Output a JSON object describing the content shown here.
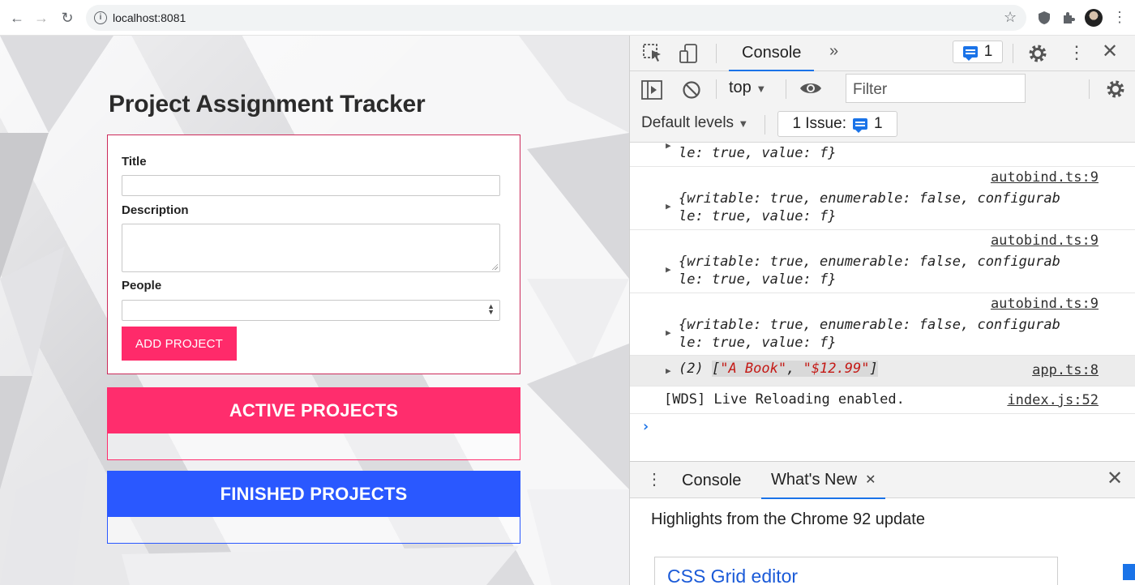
{
  "browser": {
    "url": "localhost:8081",
    "icons": [
      "back-arrow-icon",
      "forward-arrow-icon",
      "reload-icon",
      "site-info-icon",
      "bookmark-star-icon",
      "shield-extension-icon",
      "puzzle-extensions-icon",
      "profile-avatar",
      "browser-menu-icon"
    ]
  },
  "app": {
    "title": "Project Assignment Tracker",
    "form": {
      "title_label": "Title",
      "title_value": "",
      "description_label": "Description",
      "description_value": "",
      "people_label": "People",
      "people_value": "",
      "submit_label": "ADD PROJECT"
    },
    "active_heading": "ACTIVE PROJECTS",
    "finished_heading": "FINISHED PROJECTS",
    "colors": {
      "active": "#ff2d6d",
      "finished": "#2a58ff"
    }
  },
  "devtools": {
    "main_tab": "Console",
    "more_tabs_glyph": "»",
    "message_count": "1",
    "context": "top",
    "filter_placeholder": "Filter",
    "levels_label": "Default levels",
    "issues_label": "1 Issue:",
    "issues_count": "1",
    "console": {
      "partial_line": "le: true, value: f}",
      "entries": [
        {
          "source": "autobind.ts:9",
          "line1": "{writable: true, enumerable: false, configurab",
          "line2": "le: true, value: f}"
        },
        {
          "source": "autobind.ts:9",
          "line1": "{writable: true, enumerable: false, configurab",
          "line2": "le: true, value: f}"
        },
        {
          "source": "autobind.ts:9",
          "line1": "{writable: true, enumerable: false, configurab",
          "line2": "le: true, value: f}"
        }
      ],
      "array_prefix": "(2) ",
      "array_open": "[",
      "array_item1": "\"A Book\"",
      "array_sep": ", ",
      "array_item2": "\"$12.99\"",
      "array_close": "]",
      "array_source": "app.ts:8",
      "wds_text": "[WDS] Live Reloading enabled.",
      "wds_source": "index.js:52",
      "prompt_glyph": "›"
    },
    "drawer": {
      "tab_console": "Console",
      "tab_whats_new": "What's New",
      "highlights": "Highlights from the Chrome 92 update",
      "card_title": "CSS Grid editor"
    }
  }
}
